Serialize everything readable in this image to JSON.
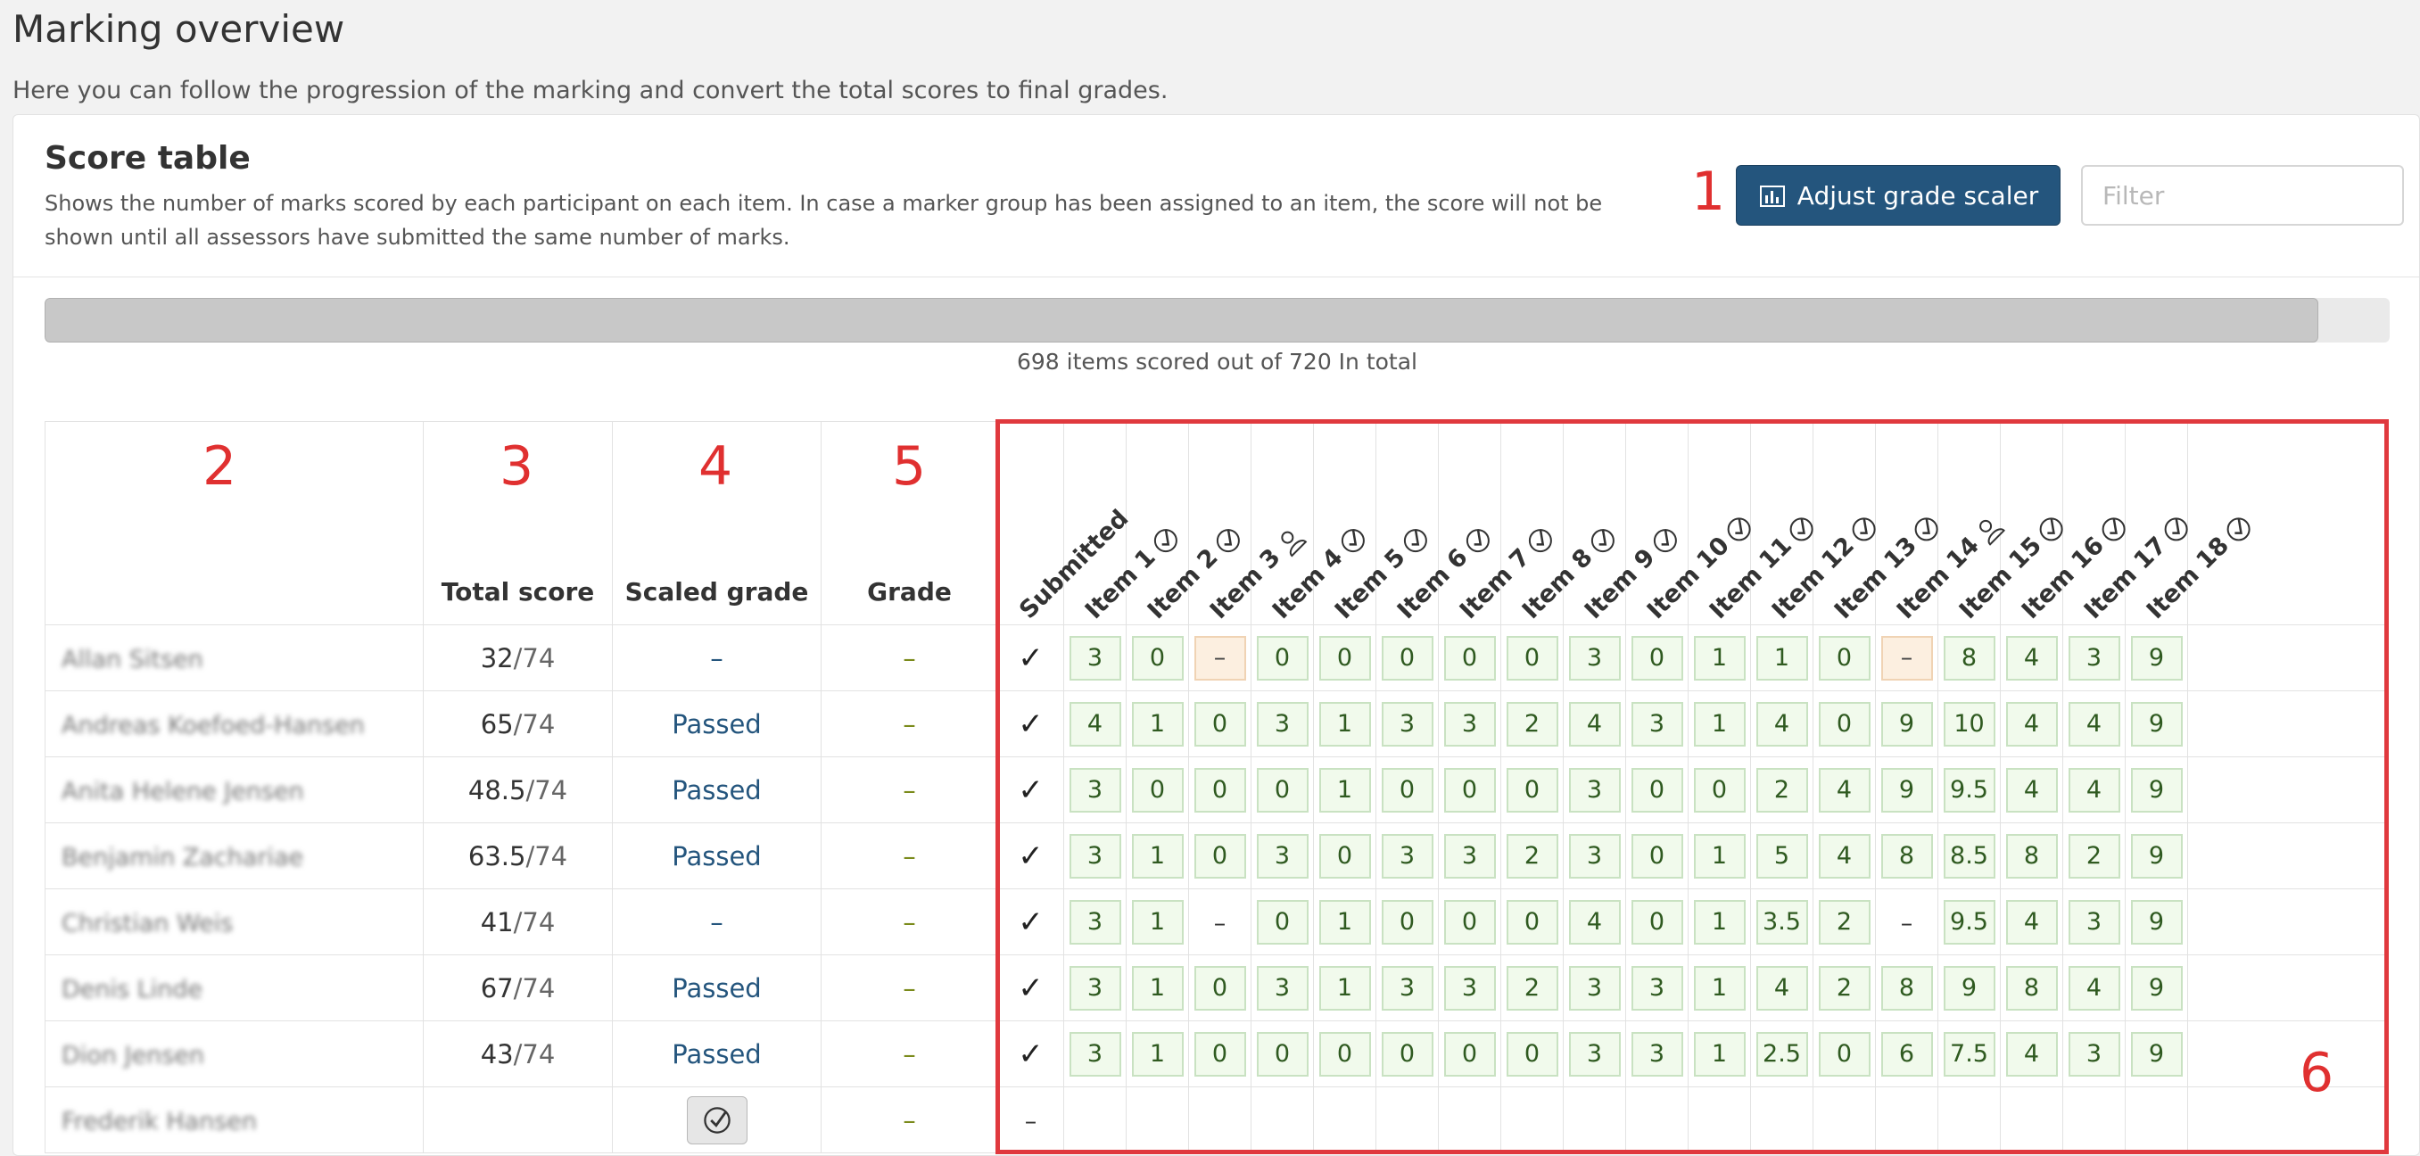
{
  "header": {
    "title": "Marking overview",
    "description": "Here you can follow the progression of the marking and convert the total scores to final grades."
  },
  "panel": {
    "title": "Score table",
    "description": "Shows the number of marks scored by each participant on each item. In case a marker group has been assigned to an item, the score will not be shown until all assessors have submitted the same number of marks.",
    "adjust_button_label": "Adjust grade scaler",
    "filter_placeholder": "Filter"
  },
  "progress": {
    "label": "698 items scored out of 720 In total",
    "scored": 698,
    "total": 720
  },
  "annotations": [
    "1",
    "2",
    "3",
    "4",
    "5",
    "6"
  ],
  "table": {
    "columns": {
      "total_score": "Total score",
      "scaled_grade": "Scaled grade",
      "grade": "Grade",
      "submitted": "Submitted"
    },
    "items": [
      {
        "label": "Item 1",
        "icon": "check-circle-icon"
      },
      {
        "label": "Item 2",
        "icon": "check-circle-icon"
      },
      {
        "label": "Item 3",
        "icon": "user-icon"
      },
      {
        "label": "Item 4",
        "icon": "check-circle-icon"
      },
      {
        "label": "Item 5",
        "icon": "check-circle-icon"
      },
      {
        "label": "Item 6",
        "icon": "check-circle-icon"
      },
      {
        "label": "Item 7",
        "icon": "check-circle-icon"
      },
      {
        "label": "Item 8",
        "icon": "check-circle-icon"
      },
      {
        "label": "Item 9",
        "icon": "check-circle-icon"
      },
      {
        "label": "Item 10",
        "icon": "check-circle-icon"
      },
      {
        "label": "Item 11",
        "icon": "check-circle-icon"
      },
      {
        "label": "Item 12",
        "icon": "check-circle-icon"
      },
      {
        "label": "Item 13",
        "icon": "check-circle-icon"
      },
      {
        "label": "Item 14",
        "icon": "user-icon"
      },
      {
        "label": "Item 15",
        "icon": "check-circle-icon"
      },
      {
        "label": "Item 16",
        "icon": "check-circle-icon"
      },
      {
        "label": "Item 17",
        "icon": "check-circle-icon"
      },
      {
        "label": "Item 18",
        "icon": "check-circle-icon"
      }
    ],
    "rows": [
      {
        "name": "Allan Sitsen",
        "score": "32",
        "max": "/74",
        "scaled": "–",
        "grade": "–",
        "submitted": "✓",
        "marks": [
          "3",
          "0",
          "–",
          "0",
          "0",
          "0",
          "0",
          "0",
          "3",
          "0",
          "1",
          "1",
          "0",
          "–",
          "8",
          "4",
          "3",
          "9"
        ],
        "mark_styles": [
          "box",
          "box",
          "missing",
          "box",
          "box",
          "box",
          "box",
          "box",
          "box",
          "box",
          "box",
          "box",
          "box",
          "missing",
          "box",
          "box",
          "box",
          "box"
        ]
      },
      {
        "name": "Andreas Koefoed-Hansen",
        "score": "65",
        "max": "/74",
        "scaled": "Passed",
        "grade": "–",
        "submitted": "✓",
        "marks": [
          "4",
          "1",
          "0",
          "3",
          "1",
          "3",
          "3",
          "2",
          "4",
          "3",
          "1",
          "4",
          "0",
          "9",
          "10",
          "4",
          "4",
          "9"
        ],
        "mark_styles": [
          "box",
          "box",
          "box",
          "box",
          "box",
          "box",
          "box",
          "box",
          "box",
          "box",
          "box",
          "box",
          "box",
          "box",
          "box",
          "box",
          "box",
          "box"
        ]
      },
      {
        "name": "Anita Helene Jensen",
        "score": "48.5",
        "max": "/74",
        "scaled": "Passed",
        "grade": "–",
        "submitted": "✓",
        "marks": [
          "3",
          "0",
          "0",
          "0",
          "1",
          "0",
          "0",
          "0",
          "3",
          "0",
          "0",
          "2",
          "4",
          "9",
          "9.5",
          "4",
          "4",
          "9"
        ],
        "mark_styles": [
          "box",
          "box",
          "box",
          "box",
          "box",
          "box",
          "box",
          "box",
          "box",
          "box",
          "box",
          "box",
          "box",
          "box",
          "box",
          "box",
          "box",
          "box"
        ]
      },
      {
        "name": "Benjamin Zachariae",
        "score": "63.5",
        "max": "/74",
        "scaled": "Passed",
        "grade": "–",
        "submitted": "✓",
        "marks": [
          "3",
          "1",
          "0",
          "3",
          "0",
          "3",
          "3",
          "2",
          "3",
          "0",
          "1",
          "5",
          "4",
          "8",
          "8.5",
          "8",
          "2",
          "9"
        ],
        "mark_styles": [
          "box",
          "box",
          "box",
          "box",
          "box",
          "box",
          "box",
          "box",
          "box",
          "box",
          "box",
          "box",
          "box",
          "box",
          "box",
          "box",
          "box",
          "box"
        ]
      },
      {
        "name": "Christian Weis",
        "score": "41",
        "max": "/74",
        "scaled": "–",
        "grade": "–",
        "submitted": "✓",
        "marks": [
          "3",
          "1",
          "–",
          "0",
          "1",
          "0",
          "0",
          "0",
          "4",
          "0",
          "1",
          "3.5",
          "2",
          "–",
          "9.5",
          "4",
          "3",
          "9"
        ],
        "mark_styles": [
          "box",
          "box",
          "plain",
          "box",
          "box",
          "box",
          "box",
          "box",
          "box",
          "box",
          "box",
          "box",
          "box",
          "plain",
          "box",
          "box",
          "box",
          "box"
        ]
      },
      {
        "name": "Denis Linde",
        "score": "67",
        "max": "/74",
        "scaled": "Passed",
        "grade": "–",
        "submitted": "✓",
        "marks": [
          "3",
          "1",
          "0",
          "3",
          "1",
          "3",
          "3",
          "2",
          "3",
          "3",
          "1",
          "4",
          "2",
          "8",
          "9",
          "8",
          "4",
          "9"
        ],
        "mark_styles": [
          "box",
          "box",
          "box",
          "box",
          "box",
          "box",
          "box",
          "box",
          "box",
          "box",
          "box",
          "box",
          "box",
          "box",
          "box",
          "box",
          "box",
          "box"
        ]
      },
      {
        "name": "Dion Jensen",
        "score": "43",
        "max": "/74",
        "scaled": "Passed",
        "grade": "–",
        "submitted": "✓",
        "marks": [
          "3",
          "1",
          "0",
          "0",
          "0",
          "0",
          "0",
          "0",
          "3",
          "3",
          "1",
          "2.5",
          "0",
          "6",
          "7.5",
          "4",
          "3",
          "9"
        ],
        "mark_styles": [
          "box",
          "box",
          "box",
          "box",
          "box",
          "box",
          "box",
          "box",
          "box",
          "box",
          "box",
          "box",
          "box",
          "box",
          "box",
          "box",
          "box",
          "box"
        ]
      },
      {
        "name": "Frederik Hansen",
        "score": "",
        "max": "",
        "scaled": "",
        "scaled_button_icon": "check-circle-icon",
        "grade": "–",
        "submitted": "–",
        "marks": [
          "",
          "",
          "",
          "",
          "",
          "",
          "",
          "",
          "",
          "",
          "",
          "",
          "",
          "",
          "",
          "",
          "",
          ""
        ],
        "mark_styles": [
          "empty",
          "empty",
          "empty",
          "empty",
          "empty",
          "empty",
          "empty",
          "empty",
          "empty",
          "empty",
          "empty",
          "empty",
          "empty",
          "empty",
          "empty",
          "empty",
          "empty",
          "empty"
        ]
      }
    ]
  },
  "colors": {
    "primary": "#24557d",
    "annotation": "#e03030",
    "mark_bg": "#f1faec",
    "mark_border": "#c9e2c2",
    "missing_bg": "#fcefe0"
  }
}
